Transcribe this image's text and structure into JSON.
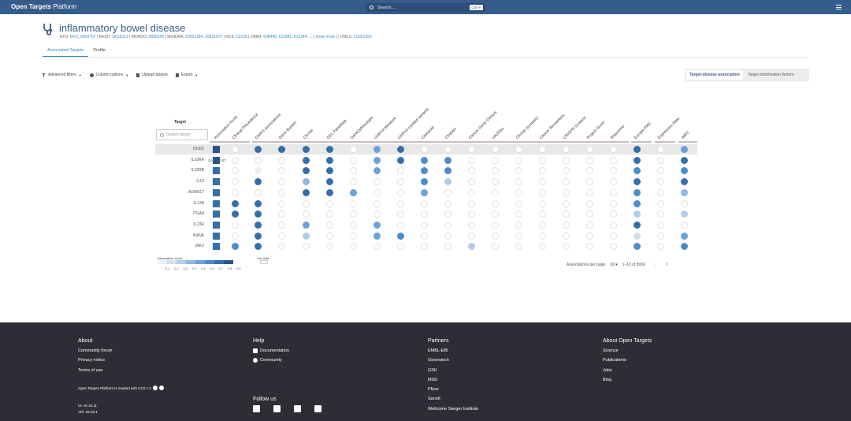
{
  "nav": {
    "brand_bold": "Open Targets",
    "brand_rest": " Platform",
    "search_placeholder": "Search...",
    "search_shortcut": "Ctrl+K"
  },
  "header": {
    "title": "inflammatory bowel disease",
    "xrefs": [
      {
        "prefix": "EFO: ",
        "link": "EFO_0003767",
        "sep": " | "
      },
      {
        "prefix": "MeSH: ",
        "link": "D015212",
        "sep": " | "
      },
      {
        "prefix": "MONDO: ",
        "link": "0005265",
        "sep": " | "
      },
      {
        "prefix": "MedDRA: ",
        "link": "10021184, 10021972",
        "sep": " | "
      },
      {
        "prefix": "NCIt: ",
        "link": "C3138",
        "sep": " | "
      },
      {
        "prefix": "OMIM: ",
        "link": "608448, 611081, 612244, ...",
        "sep": " "
      },
      {
        "prefix": "",
        "link": "[ show more ]",
        "sep": " | "
      },
      {
        "prefix": "UMLS: ",
        "link": "C0021390",
        "sep": ""
      }
    ]
  },
  "tabs": [
    "Associated Targets",
    "Profile"
  ],
  "toolbar": {
    "filters": "Advanced filters",
    "columns": "Column options",
    "upload": "Upload targets",
    "export": "Export"
  },
  "view_toggle": [
    "Target-disease association",
    "Target prioritisation factors"
  ],
  "grid": {
    "target_header": "Target",
    "search_placeholder": "Search target",
    "columns": [
      "Association Score",
      "Clinical Precedence",
      "GWAS associations",
      "Gene Burden",
      "ClinVar",
      "GEL PanelApp",
      "Gene2phenotype",
      "UniProt literature",
      "UniProt curated variants",
      "Orphanet",
      "ClinGen",
      "Cancer Gene Census",
      "IntOGen",
      "ClinVar (somatic)",
      "Cancer Biomarkers",
      "CRISPR Screens",
      "Project Score",
      "Reactome",
      "Europe PMC",
      "Expression Atlas",
      "IMPC"
    ],
    "tooltip": "Score: 0.87",
    "colors": [
      "#ffffff",
      "#e8eff7",
      "#cfdff0",
      "#b2cdea",
      "#8fb8e2",
      "#6ba2d8",
      "#4d8ccb",
      "#356fa8",
      "#28558a"
    ],
    "rows": [
      {
        "target": "NOD2",
        "assoc": 8,
        "cells": [
          0,
          7,
          7,
          7,
          7,
          0,
          5,
          7,
          0,
          0,
          0,
          0,
          0,
          0,
          0,
          0,
          0,
          7,
          0,
          5
        ]
      },
      {
        "target": "IL10RA",
        "assoc": 8,
        "cells": [
          0,
          0,
          0,
          7,
          7,
          0,
          5,
          7,
          6,
          6,
          0,
          0,
          0,
          0,
          0,
          0,
          0,
          7,
          0,
          7
        ]
      },
      {
        "target": "IL10RB",
        "assoc": 7,
        "cells": [
          0,
          1,
          0,
          7,
          7,
          0,
          5,
          0,
          6,
          6,
          0,
          0,
          0,
          0,
          0,
          0,
          0,
          6,
          0,
          6
        ]
      },
      {
        "target": "IL10",
        "assoc": 7,
        "cells": [
          0,
          7,
          0,
          4,
          7,
          0,
          0,
          0,
          6,
          3,
          0,
          0,
          0,
          0,
          0,
          0,
          0,
          7,
          0,
          7
        ]
      },
      {
        "target": "ADAM17",
        "assoc": 7,
        "cells": [
          0,
          0,
          0,
          7,
          7,
          5,
          0,
          0,
          5,
          0,
          0,
          0,
          0,
          0,
          0,
          0,
          0,
          6,
          0,
          4
        ]
      },
      {
        "target": "IL12B",
        "assoc": 7,
        "cells": [
          7,
          7,
          0,
          0,
          0,
          0,
          0,
          0,
          0,
          0,
          0,
          0,
          0,
          0,
          0,
          0,
          0,
          6,
          0,
          0
        ]
      },
      {
        "target": "ITGA4",
        "assoc": 7,
        "cells": [
          7,
          7,
          0,
          0,
          0,
          0,
          0,
          0,
          0,
          0,
          0,
          0,
          0,
          0,
          0,
          0,
          0,
          3,
          0,
          3
        ]
      },
      {
        "target": "IL23R",
        "assoc": 7,
        "cells": [
          0,
          7,
          0,
          5,
          0,
          0,
          5,
          0,
          0,
          0,
          0,
          0,
          0,
          0,
          0,
          0,
          0,
          7,
          0,
          0
        ]
      },
      {
        "target": "INAVA",
        "assoc": 7,
        "cells": [
          0,
          7,
          0,
          3,
          0,
          0,
          5,
          6,
          0,
          0,
          0,
          0,
          0,
          0,
          0,
          0,
          0,
          2,
          0,
          5
        ]
      },
      {
        "target": "JAK2",
        "assoc": 7,
        "cells": [
          6,
          7,
          0,
          0,
          0,
          0,
          0,
          0,
          0,
          0,
          3,
          0,
          0,
          0,
          0,
          0,
          0,
          6,
          0,
          6
        ]
      }
    ]
  },
  "legend": {
    "title": "Association score",
    "ticks": [
      "0.1",
      "0.2",
      "0.3",
      "0.4",
      "0.5",
      "0.6",
      "0.7",
      "0.8",
      "0.9"
    ],
    "no_data": "No data"
  },
  "pager": {
    "label": "Associations per page",
    "per_page": "10",
    "range": "1–10 of 8936"
  },
  "footer": {
    "about": {
      "title": "About",
      "items": [
        "Community forum",
        "Privacy notice",
        "Terms of use"
      ]
    },
    "help": {
      "title": "Help",
      "items": [
        "Documentation",
        "Community"
      ]
    },
    "partners": {
      "title": "Partners",
      "items": [
        "EMBL-EBI",
        "Genentech",
        "GSK",
        "MSD",
        "Pfizer",
        "Sanofi",
        "Wellcome Sanger Institute"
      ]
    },
    "about_ot": {
      "title": "About Open Targets",
      "items": [
        "Science",
        "Publications",
        "Jobs",
        "Blog"
      ]
    },
    "license": "Open Targets Platform is marked with CC0 1.0",
    "ui_version": "UI: v0.15.11",
    "api_version": "API: 26.03.1",
    "follow": "Follow us",
    "social_icons": [
      "twitter-icon",
      "linkedin-icon",
      "youtube-icon",
      "github-icon"
    ]
  }
}
